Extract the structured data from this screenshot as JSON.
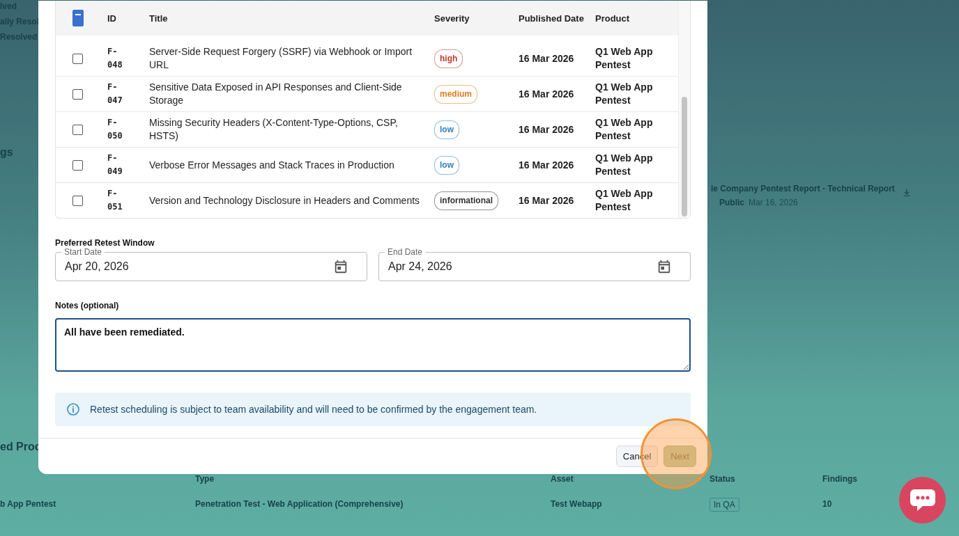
{
  "background_page": {
    "status_lines": [
      "lved",
      "ally Resol",
      "Resolved"
    ],
    "section_heading": "gs",
    "report": {
      "title": "le Company Pentest Report - Technical Report",
      "visibility": "Public",
      "date": "Mar 16, 2026"
    },
    "projects_heading": "ed Proc",
    "projects_table": {
      "columns": [
        "Type",
        "Asset",
        "Status",
        "Findings"
      ],
      "rows": [
        {
          "name": "b App Pentest",
          "type": "Penetration Test - Web Application (Comprehensive)",
          "asset": "Test Webapp",
          "status": "In QA",
          "findings": "10"
        }
      ]
    }
  },
  "dialog": {
    "table": {
      "select_all_indeterminate": true,
      "columns": [
        "ID",
        "Title",
        "Severity",
        "Published Date",
        "Product"
      ],
      "rows": [
        {
          "checked": false,
          "id": "F-048",
          "title": "Server-Side Request Forgery (SSRF) via Webhook or Import URL",
          "severity": {
            "label": "high",
            "color": "#c0392b"
          },
          "published": "16 Mar 2026",
          "product": "Q1 Web App Pentest"
        },
        {
          "checked": false,
          "id": "F-047",
          "title": "Sensitive Data Exposed in API Responses and Client-Side Storage",
          "severity": {
            "label": "medium",
            "color": "#e07b1f"
          },
          "published": "16 Mar 2026",
          "product": "Q1 Web App Pentest"
        },
        {
          "checked": false,
          "id": "F-050",
          "title": "Missing Security Headers (X-Content-Type-Options, CSP, HSTS)",
          "severity": {
            "label": "low",
            "color": "#2f7fc1"
          },
          "published": "16 Mar 2026",
          "product": "Q1 Web App Pentest"
        },
        {
          "checked": false,
          "id": "F-049",
          "title": "Verbose Error Messages and Stack Traces in Production",
          "severity": {
            "label": "low",
            "color": "#2f7fc1"
          },
          "published": "16 Mar 2026",
          "product": "Q1 Web App Pentest"
        },
        {
          "checked": false,
          "id": "F-051",
          "title": "Version and Technology Disclosure in Headers and Comments",
          "severity": {
            "label": "informational",
            "color": "#333333"
          },
          "published": "16 Mar 2026",
          "product": "Q1 Web App Pentest"
        }
      ]
    },
    "retest_window_label": "Preferred Retest Window",
    "start_date": {
      "label": "Start Date",
      "value": "Apr 20, 2026"
    },
    "end_date": {
      "label": "End Date",
      "value": "Apr 24, 2026"
    },
    "notes": {
      "label": "Notes (optional)",
      "value": "All have been remediated."
    },
    "info_message": "Retest scheduling is subject to team availability and will need to be confirmed by the engagement team.",
    "buttons": [
      {
        "label": "Cancel",
        "kind": "secondary"
      },
      {
        "label": "Next",
        "kind": "primary"
      }
    ]
  }
}
